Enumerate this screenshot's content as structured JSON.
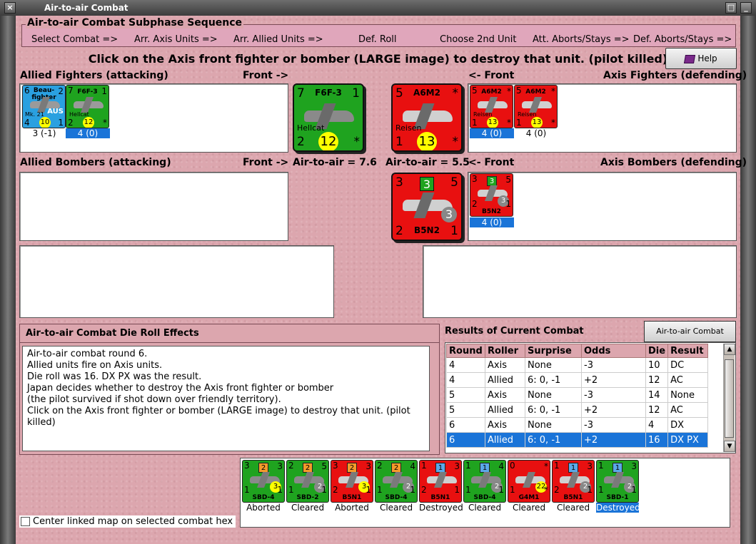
{
  "window": {
    "title": "Air-to-air Combat"
  },
  "sequence": {
    "title": "Air-to-air Combat Subphase Sequence",
    "steps": [
      "Select Combat =>",
      "Arr. Axis Units =>",
      "Arr. Allied Units =>",
      "Def. Roll",
      "Choose 2nd Unit",
      "Att. Aborts/Stays =>",
      "Def. Aborts/Stays =>"
    ]
  },
  "instruction": "Click on the Axis front fighter or bomber (LARGE image) to destroy that unit. (pilot killed)",
  "help_label": "Help",
  "labels": {
    "allied_fighters": "Allied Fighters (attacking)",
    "front_right": "Front ->",
    "front_left": "<- Front",
    "axis_fighters": "Axis Fighters (defending)",
    "allied_bombers": "Allied Bombers (attacking)",
    "front_right_2": "Front ->",
    "air_allied": "Air-to-air = 7.6",
    "air_axis": "Air-to-air = 5.5",
    "front_left_2": "<- Front",
    "axis_bombers": "Axis Bombers (defending)"
  },
  "allied_fighters": [
    {
      "name": "Beau-fighter",
      "nation": "AUS",
      "model": "Mk. 21",
      "tl": "6",
      "tr": "2",
      "bl": "4",
      "br": "1",
      "badge": "10",
      "caption": "3 (-1)",
      "selected": false,
      "color": "blue"
    },
    {
      "name": "F6F-3",
      "sub": "Hellcat",
      "tl": "7",
      "tr": "1",
      "bl": "2",
      "br": "*",
      "badge": "12",
      "caption": "4 (0)",
      "selected": true,
      "color": "green"
    }
  ],
  "allied_front": {
    "name": "F6F-3",
    "sub": "Hellcat",
    "tl": "7",
    "tr": "1",
    "bl": "2",
    "br": "*",
    "badge": "12"
  },
  "axis_front": {
    "name": "A6M2",
    "sub": "Reisen",
    "tl": "5",
    "tr": "*",
    "bl": "1",
    "br": "*",
    "badge": "13"
  },
  "axis_fighters": [
    {
      "name": "A6M2",
      "sub": "Reisen",
      "tl": "5",
      "tr": "*",
      "bl": "1",
      "br": "*",
      "badge": "13",
      "caption": "4 (0)",
      "selected": true
    },
    {
      "name": "A6M2",
      "sub": "Reisen",
      "tl": "5",
      "tr": "*",
      "bl": "1",
      "br": "*",
      "badge": "13",
      "caption": "4 (0)",
      "selected": false
    }
  ],
  "axis_bomber_front": {
    "name": "B5N2",
    "tl": "3",
    "tr": "5",
    "bl": "2",
    "br": "1",
    "box": "3",
    "badge": "3"
  },
  "axis_bombers": [
    {
      "name": "B5N2",
      "tl": "3",
      "tr": "5",
      "bl": "2",
      "br": "1",
      "box": "3",
      "badge": "3",
      "caption": "4 (0)",
      "selected": true
    }
  ],
  "effects": {
    "title": "Air-to-air Combat Die Roll Effects",
    "lines": [
      "Air-to-air combat round 6.",
      "Allied units fire on Axis units.",
      "Die roll was 16.  DX PX was the result.",
      "Japan decides whether to destroy the Axis front fighter or bomber",
      "(the pilot survived if shot down over friendly territory).",
      "Click on the Axis front fighter or bomber (LARGE image) to destroy that unit. (pilot",
      "killed)"
    ]
  },
  "results": {
    "title": "Results of Current Combat",
    "chart_button": "Air-to-air Combat Chart",
    "headers": [
      "Round",
      "Roller",
      "Surprise",
      "Odds",
      "Die",
      "Result"
    ],
    "rows": [
      [
        "4",
        "Axis",
        "None",
        "-3",
        "10",
        "DC"
      ],
      [
        "4",
        "Allied",
        "6: 0, -1",
        "+2",
        "12",
        "AC"
      ],
      [
        "5",
        "Axis",
        "None",
        "-3",
        "14",
        "None"
      ],
      [
        "5",
        "Allied",
        "6: 0, -1",
        "+2",
        "12",
        "AC"
      ],
      [
        "6",
        "Axis",
        "None",
        "-3",
        "4",
        "DX"
      ],
      [
        "6",
        "Allied",
        "6: 0, -1",
        "+2",
        "16",
        "DX PX"
      ]
    ],
    "selected_row": 5
  },
  "bottom_units": [
    {
      "name": "SBD-4",
      "color": "green",
      "tl": "3",
      "tr": "3",
      "bl": "1",
      "br": "1",
      "box": "2",
      "boxc": "or",
      "badge": "3",
      "bt": "y",
      "caption": "Aborted",
      "selected": false
    },
    {
      "name": "SBD-2",
      "color": "green",
      "tl": "2",
      "tr": "5",
      "bl": "1",
      "br": "1",
      "box": "2",
      "boxc": "or",
      "badge": "2",
      "bt": "g",
      "caption": "Cleared",
      "selected": false
    },
    {
      "name": "B5N1",
      "color": "red",
      "tl": "3",
      "tr": "3",
      "bl": "2",
      "br": "1",
      "box": "2",
      "boxc": "or",
      "badge": "3",
      "bt": "y",
      "caption": "Aborted",
      "selected": false
    },
    {
      "name": "SBD-4",
      "color": "green",
      "tl": "2",
      "tr": "4",
      "bl": "1",
      "br": "1",
      "box": "2",
      "boxc": "or",
      "badge": "2",
      "bt": "g",
      "caption": "Cleared",
      "selected": false
    },
    {
      "name": "B5N1",
      "color": "red",
      "tl": "1",
      "tr": "3",
      "bl": "2",
      "br": "1",
      "box": "1",
      "boxc": "bl",
      "badge": "",
      "bt": "",
      "caption": "Destroyed",
      "selected": false
    },
    {
      "name": "SBD-4",
      "color": "green",
      "tl": "1",
      "tr": "4",
      "bl": "1",
      "br": "1",
      "box": "1",
      "boxc": "bl",
      "badge": "2",
      "bt": "g",
      "caption": "Cleared",
      "selected": false
    },
    {
      "name": "G4M1",
      "color": "red",
      "tl": "0",
      "tr": "*",
      "bl": "1",
      "br": "*",
      "box": "",
      "boxc": "",
      "badge": "22",
      "bt": "y",
      "caption": "Cleared",
      "selected": false
    },
    {
      "name": "B5N1",
      "color": "red",
      "tl": "1",
      "tr": "3",
      "bl": "2",
      "br": "1",
      "box": "1",
      "boxc": "bl",
      "badge": "2",
      "bt": "g",
      "caption": "Cleared",
      "selected": false
    },
    {
      "name": "SBD-1",
      "color": "green",
      "tl": "1",
      "tr": "3",
      "bl": "1",
      "br": "1",
      "box": "1",
      "boxc": "bl",
      "badge": "2",
      "bt": "g",
      "caption": "Destroyed",
      "selected": true
    }
  ],
  "center_checkbox_label": "Center linked map on selected combat hex"
}
